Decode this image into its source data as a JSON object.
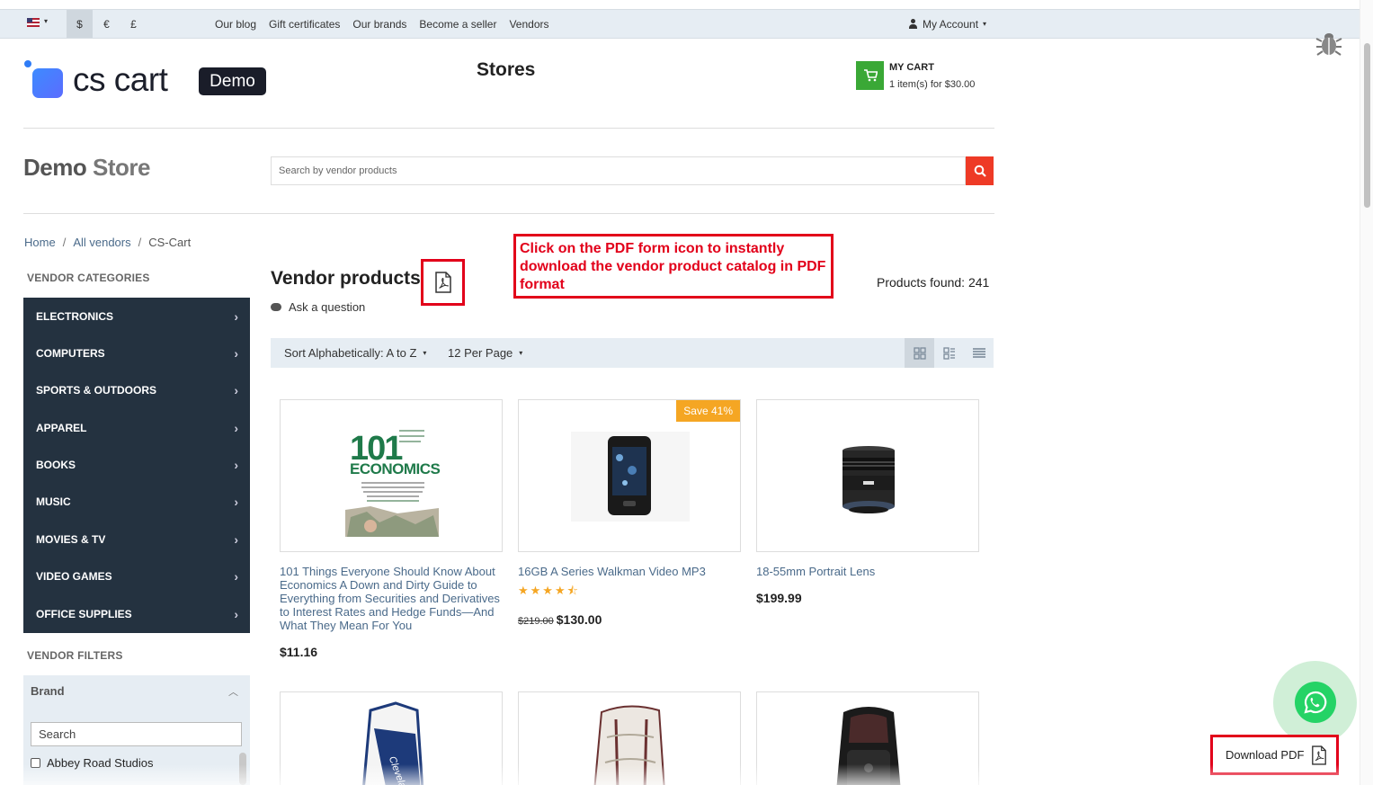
{
  "topbar": {
    "currencies": [
      {
        "symbol": "$",
        "active": true
      },
      {
        "symbol": "€",
        "active": false
      },
      {
        "symbol": "£",
        "active": false
      }
    ],
    "links": [
      "Our blog",
      "Gift certificates",
      "Our brands",
      "Become a seller",
      "Vendors"
    ],
    "account_label": "My Account"
  },
  "header": {
    "logo_text": "cs cart",
    "logo_badge": "Demo",
    "page_title": "Stores",
    "cart_title": "MY CART",
    "cart_summary": "1 item(s) for $30.00"
  },
  "store": {
    "name_part1": "Demo",
    "name_part2": "Store",
    "search_placeholder": "Search by vendor products"
  },
  "breadcrumb": [
    {
      "label": "Home",
      "link": true
    },
    {
      "label": "All vendors",
      "link": true
    },
    {
      "label": "CS-Cart",
      "link": false
    }
  ],
  "sidebar": {
    "categories_title": "VENDOR CATEGORIES",
    "categories": [
      "ELECTRONICS",
      "COMPUTERS",
      "SPORTS & OUTDOORS",
      "APPAREL",
      "BOOKS",
      "MUSIC",
      "MOVIES & TV",
      "VIDEO GAMES",
      "OFFICE SUPPLIES"
    ],
    "filters_title": "VENDOR FILTERS",
    "brand_title": "Brand",
    "brand_search_value": "Search",
    "brand_options": [
      "Abbey Road Studios"
    ]
  },
  "main": {
    "title": "Vendor products",
    "ask_question": "Ask a question",
    "products_found": "Products found: 241",
    "sort_label": "Sort Alphabetically: A to Z",
    "per_page_label": "12 Per Page",
    "view_modes": [
      "grid",
      "list",
      "compact"
    ],
    "active_view": "grid"
  },
  "callout": {
    "text": "Click on the PDF form icon to instantly download the vendor product catalog in PDF format",
    "color": "#e2001a"
  },
  "products": [
    {
      "title": "101 Things Everyone Should Know About Economics A Down and Dirty Guide to Everything from Securities and Derivatives to Interest Rates and Hedge Funds—And What They Mean For You",
      "price": "$11.16",
      "old_price": "",
      "badge": "",
      "rating": 0,
      "image": "book-cover",
      "cover_title_1": "101",
      "cover_title_2": "ECONOMICS"
    },
    {
      "title": "16GB A Series Walkman Video MP3",
      "price": "$130.00",
      "old_price": "$219.00",
      "badge": "Save 41%",
      "rating": 4.5,
      "image": "mp3-player"
    },
    {
      "title": "18-55mm Portrait Lens",
      "price": "$199.99",
      "old_price": "",
      "badge": "",
      "rating": 0,
      "image": "camera-lens"
    },
    {
      "title": "",
      "price": "",
      "image": "golf-bag",
      "bag_text": "Cleveland"
    },
    {
      "title": "",
      "price": "",
      "image": "white-backpack"
    },
    {
      "title": "",
      "price": "",
      "image": "black-backpack"
    }
  ],
  "floating": {
    "download_pdf": "Download PDF",
    "whatsapp_icon": "whatsapp-icon",
    "brand_green": "#25d366",
    "accent_red": "#ee3a26"
  }
}
